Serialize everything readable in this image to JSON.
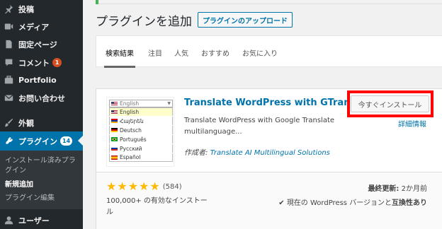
{
  "sidebar": {
    "items": [
      {
        "label": "投稿",
        "icon": "pin-icon"
      },
      {
        "label": "メディア",
        "icon": "media-icon"
      },
      {
        "label": "固定ページ",
        "icon": "page-icon"
      },
      {
        "label": "コメント",
        "icon": "comment-icon",
        "badge": "1"
      },
      {
        "label": "Portfolio",
        "icon": "portfolio-icon"
      },
      {
        "label": "お問い合わせ",
        "icon": "mail-icon"
      },
      {
        "label": "外観",
        "icon": "brush-icon"
      },
      {
        "label": "プラグイン",
        "icon": "plugin-icon",
        "badge": "14"
      },
      {
        "label": "ユーザー",
        "icon": "user-icon"
      }
    ],
    "submenu": [
      "インストール済みプラグイン",
      "新規追加",
      "プラグイン編集"
    ]
  },
  "page": {
    "title": "プラグインを追加",
    "upload_label": "プラグインのアップロード"
  },
  "filter_tabs": [
    "検索結果",
    "注目",
    "人気",
    "おすすめ",
    "お気に入り"
  ],
  "plugin": {
    "name": "Translate WordPress with GTranslate",
    "description": "Translate WordPress with Google Translate multilanguage...",
    "author_prefix": "作成者:",
    "author": "Translate AI Multilingual Solutions",
    "install_label": "今すぐインストール",
    "details_label": "詳細情報",
    "rating_count": "(584)",
    "installs": "100,000+ の有効なインストール",
    "updated_label": "最終更新:",
    "updated_value": "2か月前",
    "compat_prefix": "現在の WordPress バージョンと",
    "compat_value": "互換性あり",
    "thumbnail": {
      "selected": "English",
      "languages": [
        "English",
        "Հայերեն",
        "Deutsch",
        "Português",
        "Русский",
        "Español"
      ]
    }
  },
  "colors": {
    "accent": "#0073aa",
    "sidebar_bg": "#23282d",
    "star": "#ffb900",
    "highlight": "#ff0000"
  }
}
